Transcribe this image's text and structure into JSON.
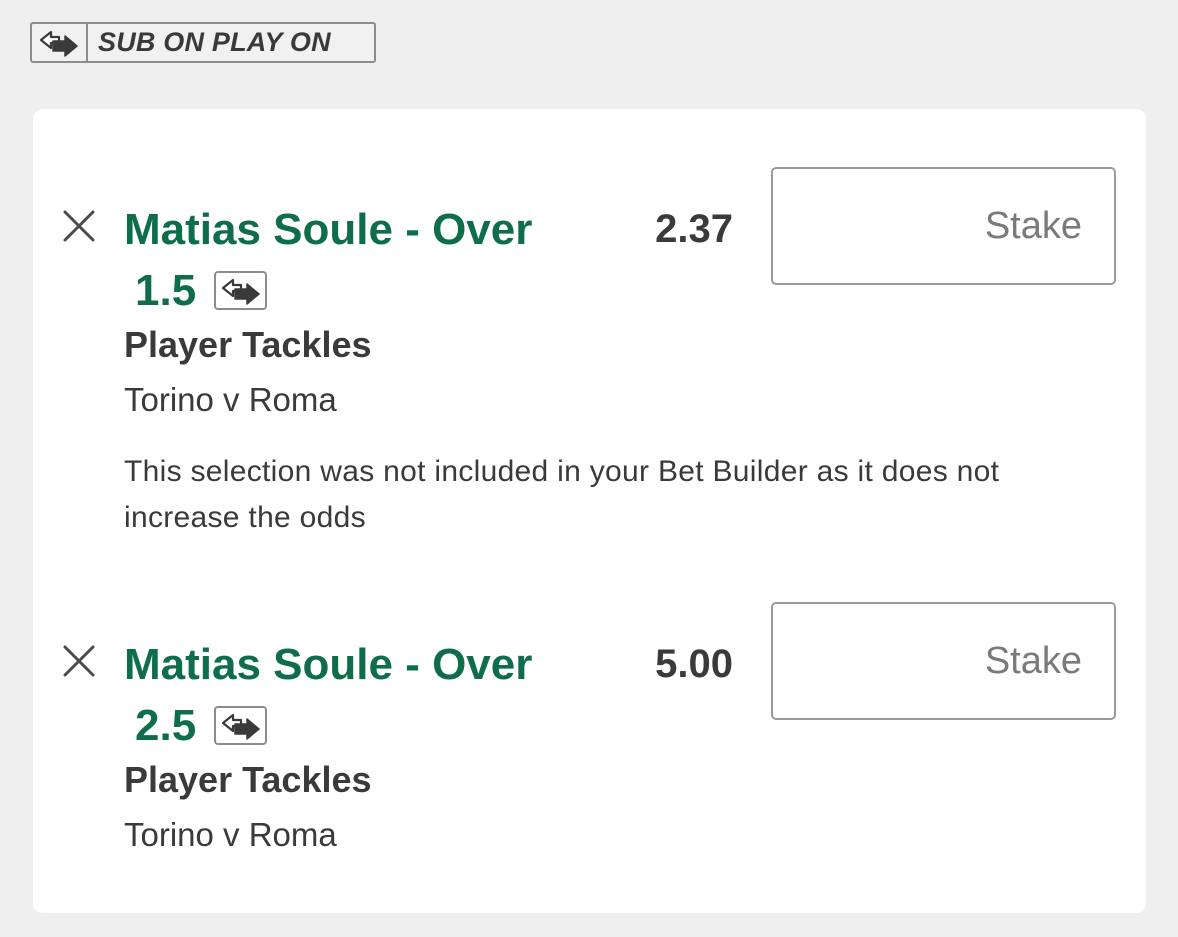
{
  "header": {
    "sub_on_play_on_label": "SUB ON PLAY ON",
    "icon": "sub-swap-icon"
  },
  "colors": {
    "selection_green": "#0f6e4a",
    "text_dark": "#3a3a3a",
    "border_gray": "#8c8c8c",
    "background": "#efefef",
    "card": "#ffffff"
  },
  "bets": [
    {
      "selection_line1": "Matias Soule - Over",
      "selection_line2": "1.5",
      "odds": "2.37",
      "stake_placeholder": "Stake",
      "market": "Player Tackles",
      "event": "Torino v Roma",
      "note": "This selection was not included in your Bet Builder as it does not increase the odds",
      "remove_icon": "close-icon",
      "sub_icon": "sub-swap-icon"
    },
    {
      "selection_line1": "Matias Soule - Over",
      "selection_line2": "2.5",
      "odds": "5.00",
      "stake_placeholder": "Stake",
      "market": "Player Tackles",
      "event": "Torino v Roma",
      "remove_icon": "close-icon",
      "sub_icon": "sub-swap-icon"
    }
  ]
}
